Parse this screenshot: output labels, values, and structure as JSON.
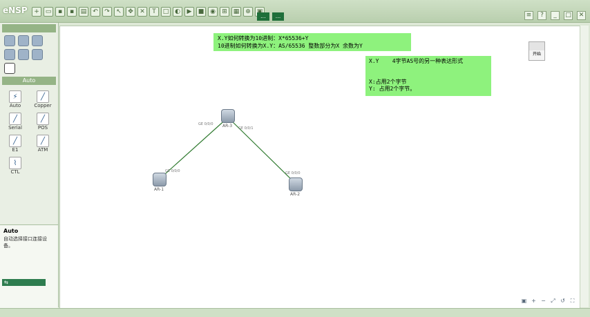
{
  "app": {
    "title": "eNSP"
  },
  "toolbar": {
    "center_btn1": "...",
    "center_btn2": "..."
  },
  "left_panel": {
    "device_header": "",
    "cable_header": "Auto",
    "cables": [
      {
        "label": "Auto",
        "glyph": "⚡"
      },
      {
        "label": "Copper",
        "glyph": "╱"
      },
      {
        "label": "Serial",
        "glyph": "╱"
      },
      {
        "label": "POS",
        "glyph": "╱"
      },
      {
        "label": "E1",
        "glyph": "╱"
      },
      {
        "label": "ATM",
        "glyph": "╱"
      },
      {
        "label": "CTL",
        "glyph": "⌇"
      }
    ],
    "desc_title": "Auto",
    "desc_text": "自动选择接口连接设备。"
  },
  "notes": {
    "note1_line1": "X.Y如何转换为10进制：X*65536+Y",
    "note1_line2": "10进制如何转换为X.Y：AS/65536   整数部分为X  余数为Y",
    "note2_line1": "X.Y    4字节AS号的另一种表达形式",
    "note2_line2": "X:占用2个字节",
    "note2_line3": "Y: 占用2个字节。"
  },
  "topology": {
    "routers": [
      {
        "name": "AR-3"
      },
      {
        "name": "AR-1"
      },
      {
        "name": "AR-2"
      }
    ],
    "links": [
      {
        "from": "AR-3",
        "to": "AR-1",
        "label_a": "GE 0/0/0",
        "label_b": "GE 0/0/0"
      },
      {
        "from": "AR-3",
        "to": "AR-2",
        "label_a": "GE 0/0/1",
        "label_b": "GE 0/0/0"
      }
    ],
    "link_color": "#2f7a2f"
  },
  "side_tool": {
    "label": "开始"
  }
}
